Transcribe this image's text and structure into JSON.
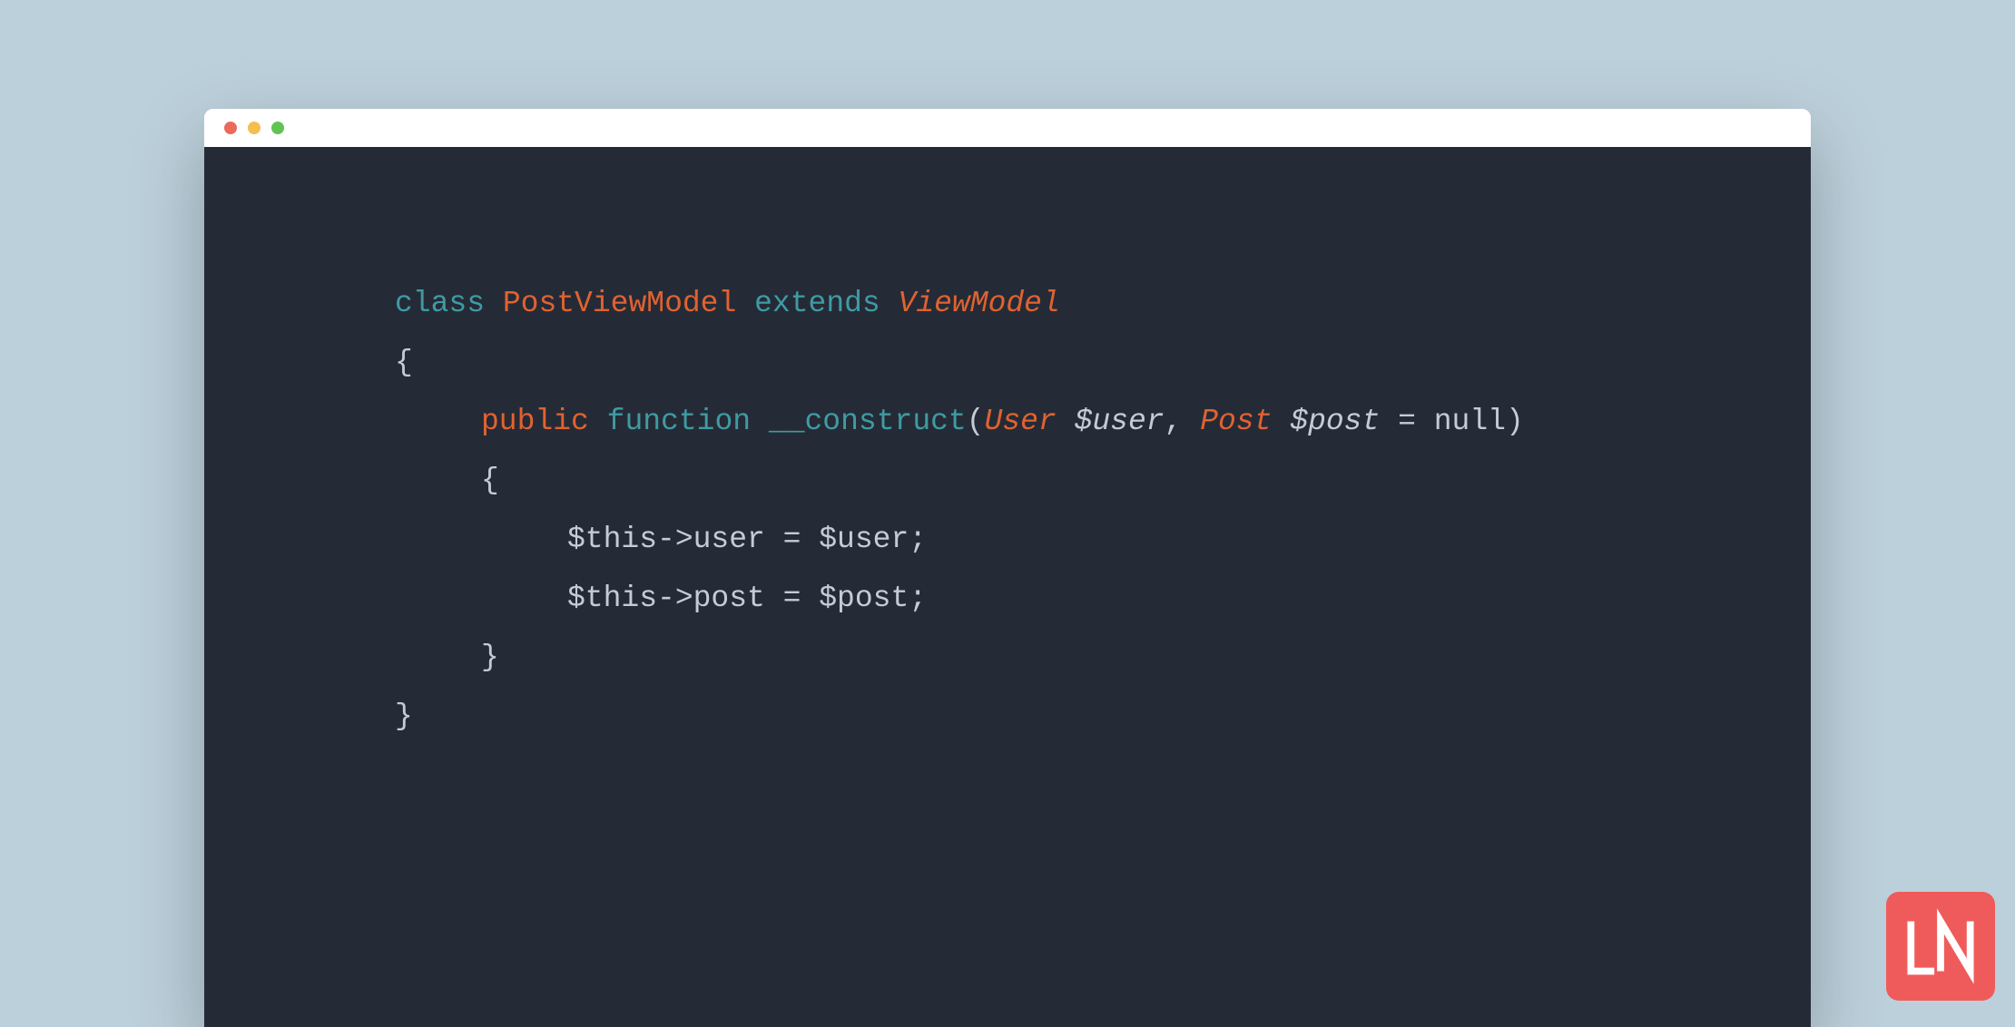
{
  "code": {
    "line1": {
      "class_kw": "class",
      "class_name": "PostViewModel",
      "extends_kw": "extends",
      "parent": "ViewModel"
    },
    "brace_open": "{",
    "line3": {
      "modifier": "public",
      "function_kw": "function",
      "name": "__construct",
      "paren_open": "(",
      "type1": "User",
      "var1": "$user",
      "comma": ",",
      "type2": "Post",
      "var2": "$post",
      "equals": " = ",
      "null_val": "null",
      "paren_close": ")"
    },
    "brace_open2": "{",
    "line5": "$this->user = $user;",
    "line6": "$this->post = $post;",
    "brace_close2": "}",
    "brace_close": "}"
  },
  "logo": {
    "text": "LN"
  },
  "colors": {
    "background": "#bcd0db",
    "editor_bg": "#252b36",
    "keyword": "#3e9ba4",
    "classname": "#e06231",
    "text": "#c4cbd7",
    "logo_bg": "#ef5b5b"
  }
}
